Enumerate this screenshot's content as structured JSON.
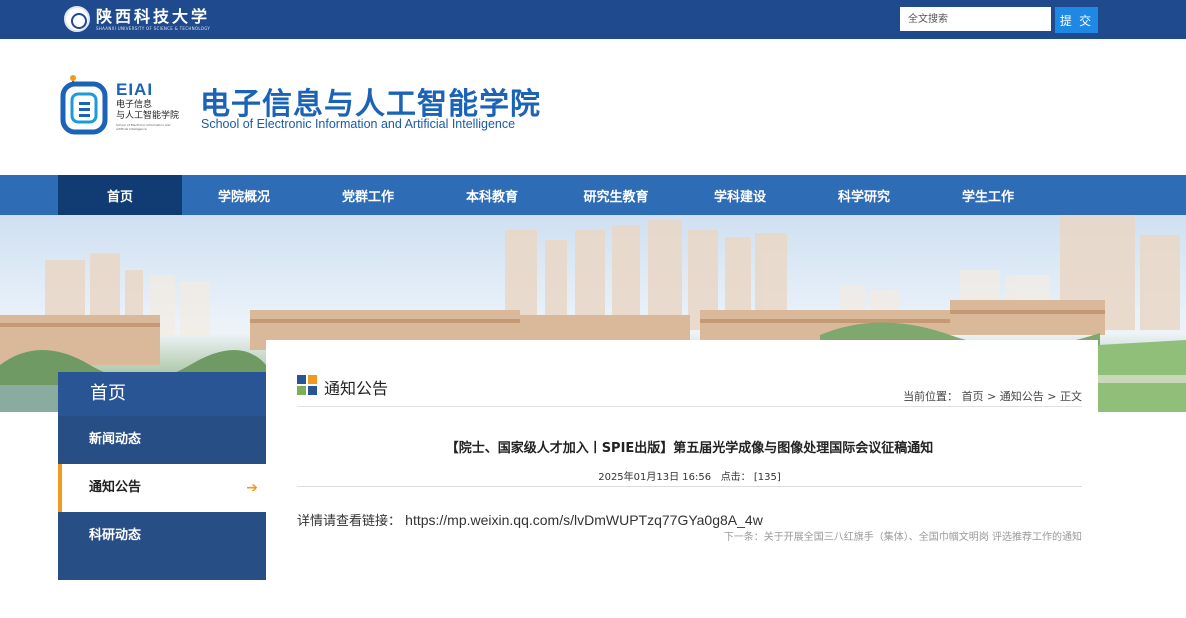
{
  "topbar": {
    "university_name": "陕西科技大学",
    "university_en": "SHAANXI UNIVERSITY OF SCIENCE & TECHNOLOGY",
    "search_placeholder": "全文搜索",
    "search_button": "提 交"
  },
  "header": {
    "logo_mark": "EIAI",
    "logo_cn_line1": "电子信息",
    "logo_cn_line2": "与人工智能学院",
    "logo_en": "School of Electronic Information and Artificial Intelligence",
    "college_cn": "电子信息与人工智能学院",
    "college_en": "School of Electronic Information and Artificial Intelligence"
  },
  "nav": {
    "items": [
      "首页",
      "学院概况",
      "党群工作",
      "本科教育",
      "研究生教育",
      "学科建设",
      "科学研究",
      "学生工作"
    ],
    "active_index": 0
  },
  "sidebar": {
    "title": "首页",
    "items": [
      "新闻动态",
      "通知公告",
      "科研动态"
    ],
    "active_index": 1,
    "active_arrow": "➔"
  },
  "main": {
    "section_title": "通知公告",
    "breadcrumb": {
      "label": "当前位置：",
      "home": "首页",
      "sep": ">",
      "section": "通知公告",
      "current": "正文"
    },
    "article": {
      "title": "【院士、国家级人才加入丨SPIE出版】第五届光学成像与图像处理国际会议征稿通知",
      "date": "2025年01月13日 16:56",
      "clicks_label": "点击：",
      "clicks": "[135]",
      "body_label": "详情请查看链接：",
      "body_url": "https://mp.weixin.qq.com/s/lvDmWUPTzq77GYa0g8A_4w"
    },
    "next_link": "下一条：关于开展全国三八红旗手（集体）、全国巾帼文明岗 评选推荐工作的通知"
  },
  "colors": {
    "topbar": "#1f4b8e",
    "nav": "#2f6cb6",
    "nav_active": "#103b73",
    "sidebar": "#284e86",
    "accent_orange": "#f29a1e",
    "brand_blue": "#1b63b7"
  }
}
